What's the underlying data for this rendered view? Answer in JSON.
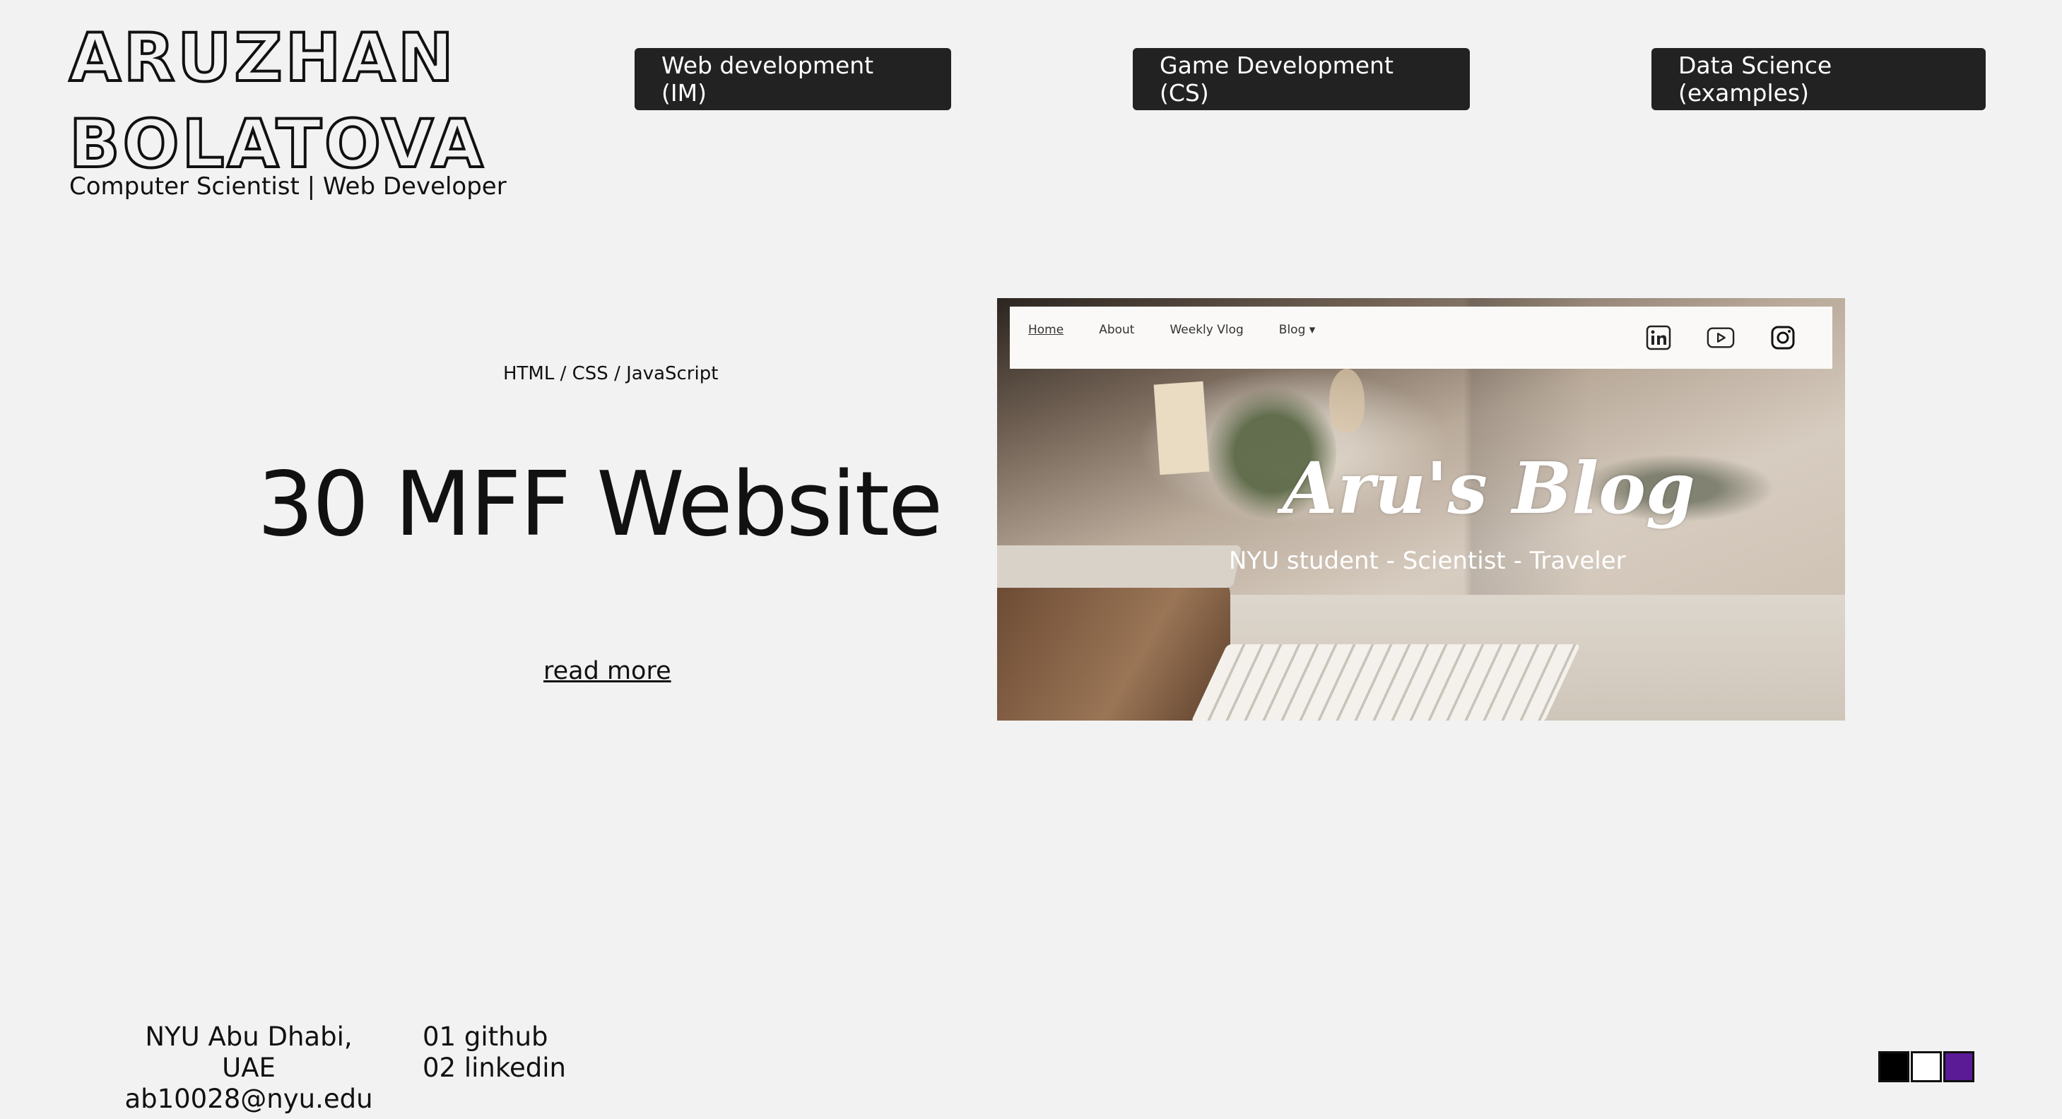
{
  "header": {
    "name_line1": "ARUZHAN",
    "name_line2": "BOLATOVA",
    "subtitle": "Computer Scientist | Web Developer"
  },
  "nav": {
    "web_dev": "Web development (IM)",
    "game_dev": "Game Development (CS)",
    "data_science": "Data Science (examples)"
  },
  "project": {
    "tech": "HTML / CSS / JavaScript",
    "title": "30 MFF Website",
    "read_more": "read more"
  },
  "preview": {
    "nav": [
      "Home",
      "About",
      "Weekly Vlog",
      "Blog ▾"
    ],
    "blog_title": "Aru's Blog",
    "blog_subtitle": "NYU student - Scientist - Traveler",
    "icons": [
      "linkedin-icon",
      "youtube-icon",
      "instagram-icon"
    ]
  },
  "footer": {
    "location": "NYU Abu Dhabi, UAE",
    "email": "ab10028@nyu.edu",
    "link1": "01 github",
    "link2": "02 linkedin"
  },
  "theme_swatches": [
    "#000000",
    "#ffffff",
    "#5b1a96"
  ]
}
